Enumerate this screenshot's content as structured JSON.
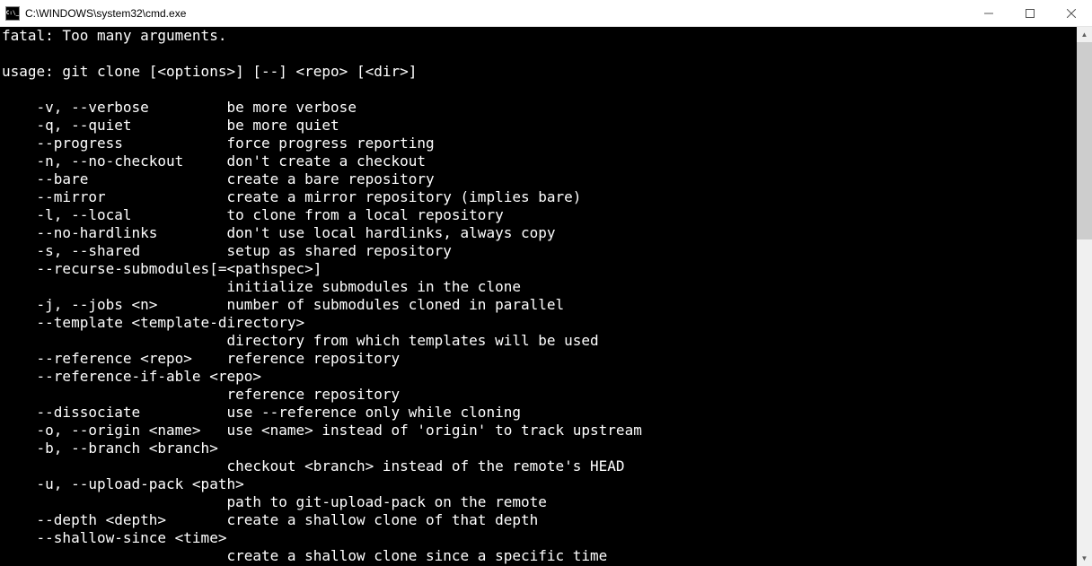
{
  "window": {
    "title": "C:\\WINDOWS\\system32\\cmd.exe"
  },
  "terminal": {
    "lines": [
      "fatal: Too many arguments.",
      "",
      "usage: git clone [<options>] [--] <repo> [<dir>]",
      "",
      "    -v, --verbose         be more verbose",
      "    -q, --quiet           be more quiet",
      "    --progress            force progress reporting",
      "    -n, --no-checkout     don't create a checkout",
      "    --bare                create a bare repository",
      "    --mirror              create a mirror repository (implies bare)",
      "    -l, --local           to clone from a local repository",
      "    --no-hardlinks        don't use local hardlinks, always copy",
      "    -s, --shared          setup as shared repository",
      "    --recurse-submodules[=<pathspec>]",
      "                          initialize submodules in the clone",
      "    -j, --jobs <n>        number of submodules cloned in parallel",
      "    --template <template-directory>",
      "                          directory from which templates will be used",
      "    --reference <repo>    reference repository",
      "    --reference-if-able <repo>",
      "                          reference repository",
      "    --dissociate          use --reference only while cloning",
      "    -o, --origin <name>   use <name> instead of 'origin' to track upstream",
      "    -b, --branch <branch>",
      "                          checkout <branch> instead of the remote's HEAD",
      "    -u, --upload-pack <path>",
      "                          path to git-upload-pack on the remote",
      "    --depth <depth>       create a shallow clone of that depth",
      "    --shallow-since <time>",
      "                          create a shallow clone since a specific time"
    ]
  }
}
